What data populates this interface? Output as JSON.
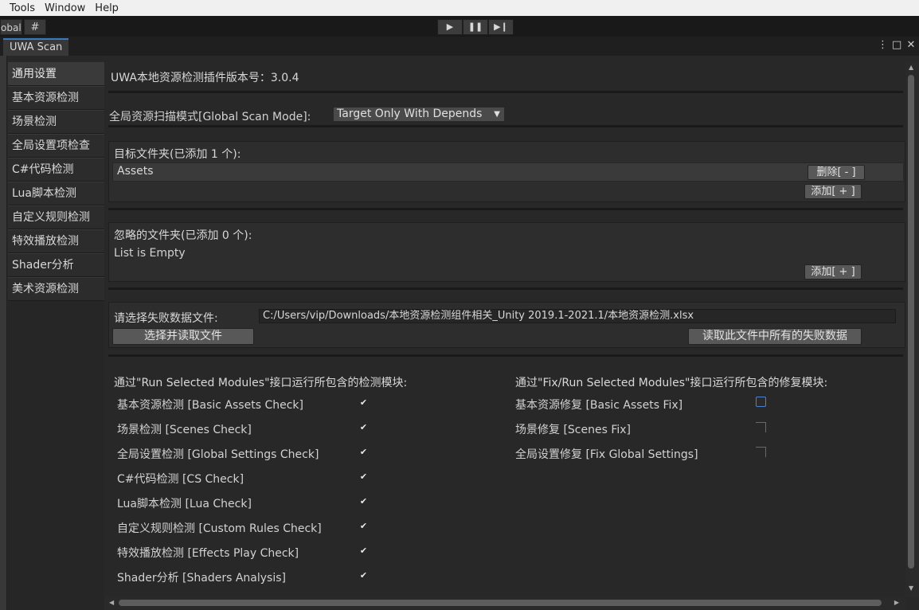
{
  "menu": [
    "Tools",
    "Window",
    "Help"
  ],
  "toolbar": {
    "global_label": "obal",
    "grid_icon": "#",
    "play": "▶",
    "pause": "❚❚",
    "step": "▶❙"
  },
  "tab": {
    "title": "UWA Scan",
    "menu_icon": "⋮",
    "maximize_icon": "□",
    "close_icon": "✕"
  },
  "sidebar": {
    "items": [
      "通用设置",
      "基本资源检测",
      "场景检测",
      "全局设置项检查",
      "C#代码检测",
      "Lua脚本检测",
      "自定义规则检测",
      "特效播放检测",
      "Shader分析",
      "美术资源检测"
    ]
  },
  "main": {
    "version": "UWA本地资源检测插件版本号：3.0.4",
    "scan_mode_label": "全局资源扫描模式[Global Scan Mode]:",
    "scan_mode_value": "Target Only With Depends",
    "target_title": "目标文件夹(已添加 1 个):",
    "target_item": "Assets",
    "delete_btn": "删除[ - ]",
    "add_btn": "添加[ + ]",
    "ignore_title": "忽略的文件夹(已添加 0 个):",
    "ignore_empty": "List is Empty",
    "ignore_add_btn": "添加[ + ]",
    "fail_file_label": "请选择失败数据文件:",
    "fail_file_path": "C:/Users/vip/Downloads/本地资源检测组件相关_Unity 2019.1-2021.1/本地资源检测.xlsx",
    "choose_btn": "选择并读取文件",
    "read_all_btn": "读取此文件中所有的失败数据",
    "run_header": "通过\"Run Selected Modules\"接口运行所包含的检测模块:",
    "fix_header": "通过\"Fix/Run Selected Modules\"接口运行所包含的修复模块:",
    "run_modules": [
      "基本资源检测 [Basic Assets Check]",
      "场景检测 [Scenes Check]",
      "全局设置检测 [Global Settings Check]",
      "C#代码检测 [CS Check]",
      "Lua脚本检测 [Lua Check]",
      "自定义规则检测 [Custom Rules Check]",
      "特效播放检测 [Effects Play Check]",
      "Shader分析 [Shaders Analysis]"
    ],
    "fix_modules": [
      "基本资源修复 [Basic Assets Fix]",
      "场景修复 [Scenes Fix]",
      "全局设置修复 [Fix Global Settings]"
    ],
    "check_mark": "✔"
  },
  "colors": {
    "accent": "#3a79bb",
    "background": "#282828",
    "panel": "#2d2d2d"
  }
}
